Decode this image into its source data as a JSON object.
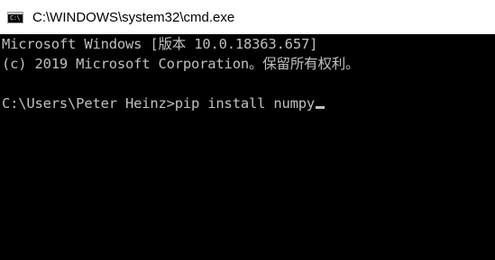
{
  "window": {
    "title": "C:\\WINDOWS\\system32\\cmd.exe",
    "icon": "cmd-console-icon",
    "icon_glyph": "C:\\"
  },
  "console": {
    "lines": [
      "Microsoft Windows [版本 10.0.18363.657]",
      "(c) 2019 Microsoft Corporation。保留所有权利。",
      "",
      "C:\\Users\\Peter Heinz>pip install numpy"
    ]
  },
  "colors": {
    "console_background": "#000000",
    "console_text": "#c0c0c0",
    "titlebar_background": "#ffffff"
  }
}
